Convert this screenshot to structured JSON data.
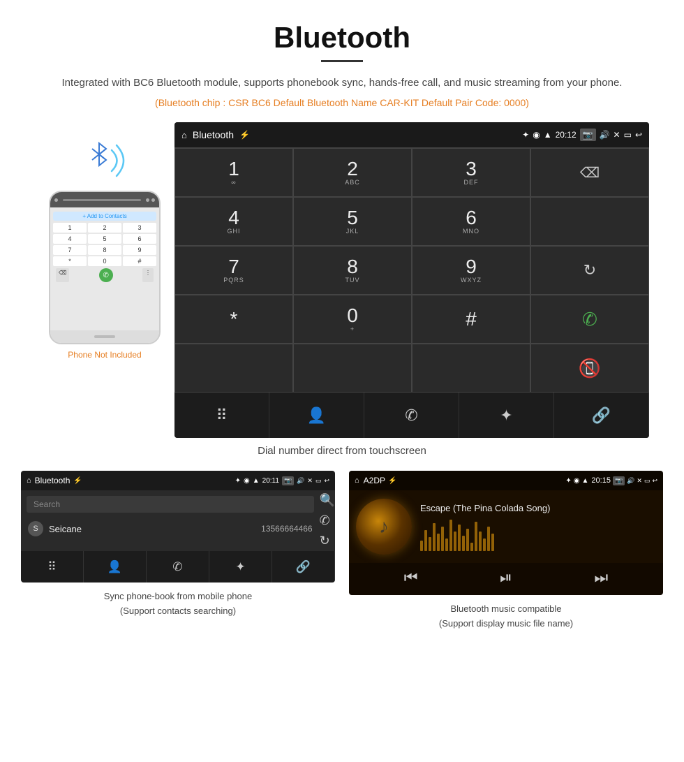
{
  "page": {
    "title": "Bluetooth",
    "subtitle": "Integrated with BC6 Bluetooth module, supports phonebook sync, hands-free call, and music streaming from your phone.",
    "specs": "(Bluetooth chip : CSR BC6    Default Bluetooth Name CAR-KIT    Default Pair Code: 0000)",
    "dial_caption": "Dial number direct from touchscreen",
    "phone_not_included": "Phone Not Included",
    "bottom_left_caption_line1": "Sync phone-book from mobile phone",
    "bottom_left_caption_line2": "(Support contacts searching)",
    "bottom_right_caption_line1": "Bluetooth music compatible",
    "bottom_right_caption_line2": "(Support display music file name)"
  },
  "android_dial": {
    "screen_title": "Bluetooth",
    "time": "20:12",
    "keys": [
      {
        "num": "1",
        "sub": ""
      },
      {
        "num": "2",
        "sub": "ABC"
      },
      {
        "num": "3",
        "sub": "DEF"
      },
      {
        "num": "",
        "sub": ""
      },
      {
        "num": "4",
        "sub": "GHI"
      },
      {
        "num": "5",
        "sub": "JKL"
      },
      {
        "num": "6",
        "sub": "MNO"
      },
      {
        "num": "",
        "sub": ""
      },
      {
        "num": "7",
        "sub": "PQRS"
      },
      {
        "num": "8",
        "sub": "TUV"
      },
      {
        "num": "9",
        "sub": "WXYZ"
      },
      {
        "num": "",
        "sub": ""
      },
      {
        "num": "*",
        "sub": ""
      },
      {
        "num": "0",
        "sub": "+"
      },
      {
        "num": "#",
        "sub": ""
      },
      {
        "num": "",
        "sub": ""
      }
    ]
  },
  "phonebook": {
    "screen_title": "Bluetooth",
    "time": "20:11",
    "search_placeholder": "Search",
    "contact_name": "Seicane",
    "contact_phone": "13566664466"
  },
  "music": {
    "screen_title": "A2DP",
    "time": "20:15",
    "song_title": "Escape (The Pina Colada Song)"
  },
  "phone_screen": {
    "add_label": "+ Add to Contacts",
    "dial_keys": [
      "1",
      "2",
      "3",
      "4",
      "5",
      "6",
      "7",
      "8",
      "9",
      "*",
      "0",
      "#"
    ]
  }
}
